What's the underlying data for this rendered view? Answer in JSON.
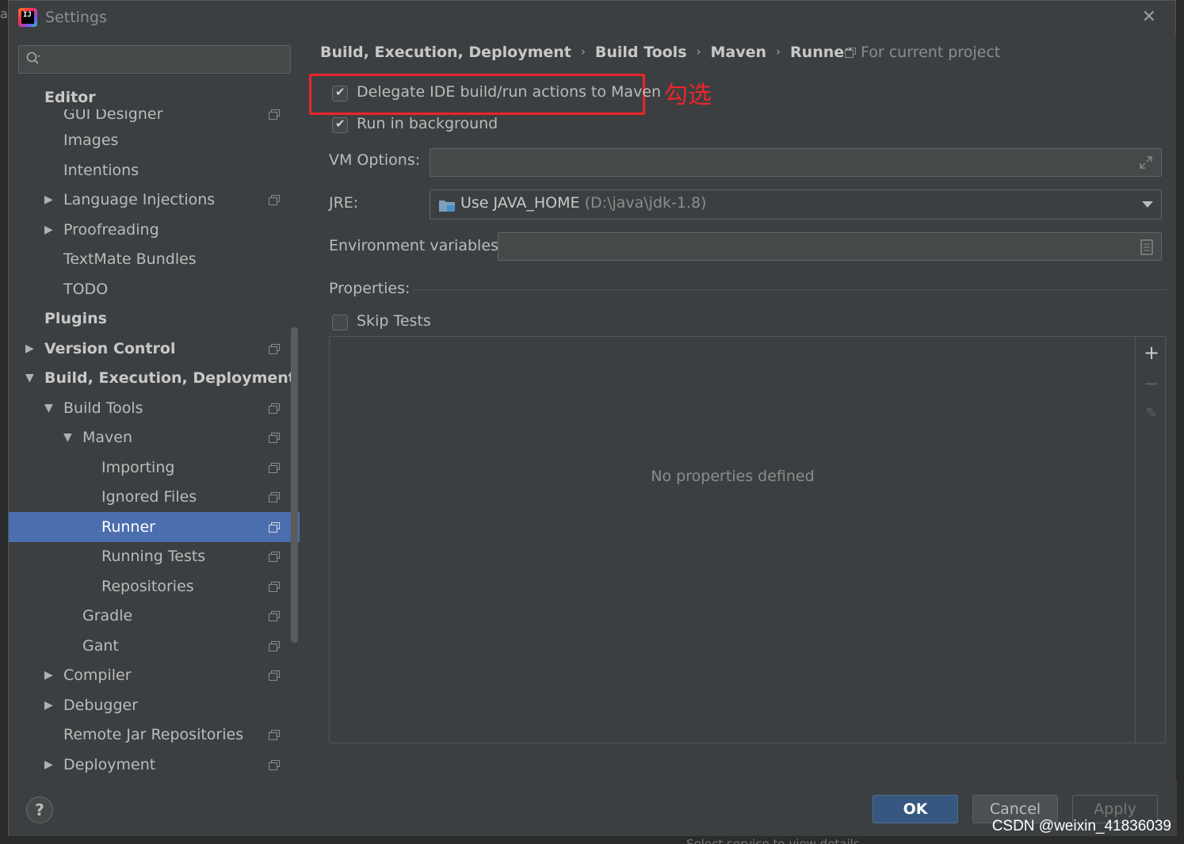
{
  "window": {
    "title": "Settings",
    "app_icon_text": "IJ",
    "left_fragment": "a",
    "bg_fragment": "Select service to view details"
  },
  "search": {
    "placeholder": "",
    "value": ""
  },
  "sidebar": {
    "items": [
      {
        "label": "GUI Designer"
      },
      {
        "label": "Editor"
      },
      {
        "label": "Images"
      },
      {
        "label": "Intentions"
      },
      {
        "label": "Language Injections"
      },
      {
        "label": "Proofreading"
      },
      {
        "label": "TextMate Bundles"
      },
      {
        "label": "TODO"
      },
      {
        "label": "Plugins"
      },
      {
        "label": "Version Control"
      },
      {
        "label": "Build, Execution, Deployment"
      },
      {
        "label": "Build Tools"
      },
      {
        "label": "Maven"
      },
      {
        "label": "Importing"
      },
      {
        "label": "Ignored Files"
      },
      {
        "label": "Runner"
      },
      {
        "label": "Running Tests"
      },
      {
        "label": "Repositories"
      },
      {
        "label": "Gradle"
      },
      {
        "label": "Gant"
      },
      {
        "label": "Compiler"
      },
      {
        "label": "Debugger"
      },
      {
        "label": "Remote Jar Repositories"
      },
      {
        "label": "Deployment"
      }
    ]
  },
  "breadcrumb": {
    "items": [
      "Build, Execution, Deployment",
      "Build Tools",
      "Maven",
      "Runner"
    ],
    "separator": "›",
    "scope": "For current project"
  },
  "runner": {
    "delegate_label": "Delegate IDE build/run actions to Maven",
    "delegate_checked": true,
    "background_label": "Run in background",
    "background_checked": true,
    "vm_options_label": "VM Options:",
    "vm_options_value": "",
    "jre_label": "JRE:",
    "jre_value": "Use JAVA_HOME",
    "jre_path": "(D:\\java\\jdk-1.8)",
    "env_label": "Environment variables:",
    "env_value": "",
    "properties_label": "Properties:",
    "skip_tests_label": "Skip Tests",
    "skip_tests_checked": false,
    "empty_properties": "No properties defined"
  },
  "annotation": {
    "text": "勾选",
    "color": "#e8262b"
  },
  "buttons": {
    "help": "?",
    "ok": "OK",
    "cancel": "Cancel",
    "apply": "Apply"
  },
  "watermark": "CSDN @weixin_41836039",
  "colors": {
    "selection": "#4b6eaf",
    "ok_button": "#365880",
    "annotation_red": "#e8262b"
  }
}
